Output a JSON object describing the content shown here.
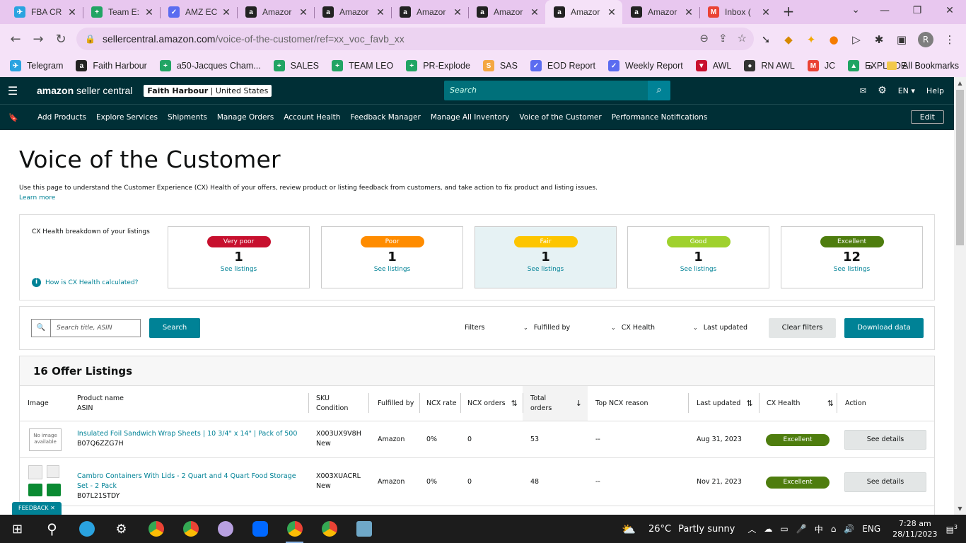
{
  "browser": {
    "tabs": [
      {
        "title": "FBA CR",
        "icon": "telegram-icon",
        "color": "#2aa3e0",
        "glyph": "✈"
      },
      {
        "title": "Team E:",
        "icon": "sheets-icon",
        "color": "#21a464",
        "glyph": "+"
      },
      {
        "title": "AMZ EC",
        "icon": "eod-icon",
        "color": "#5b6cf0",
        "glyph": "✓"
      },
      {
        "title": "Amazor",
        "icon": "amazon-icon",
        "color": "#222222",
        "glyph": "a"
      },
      {
        "title": "Amazor",
        "icon": "amazon-icon",
        "color": "#222222",
        "glyph": "a"
      },
      {
        "title": "Amazor",
        "icon": "amazon-icon",
        "color": "#222222",
        "glyph": "a"
      },
      {
        "title": "Amazor",
        "icon": "amazon-icon",
        "color": "#222222",
        "glyph": "a"
      },
      {
        "title": "Amazor",
        "icon": "amazon-icon",
        "color": "#222222",
        "glyph": "a",
        "active": true
      },
      {
        "title": "Amazor",
        "icon": "amazon-icon",
        "color": "#222222",
        "glyph": "a"
      },
      {
        "title": "Inbox (",
        "icon": "gmail-icon",
        "color": "#ea4335",
        "glyph": "M"
      }
    ],
    "url_host": "sellercentral.amazon.com",
    "url_path": "/voice-of-the-customer/ref=xx_voc_favb_xx",
    "bookmarks": [
      {
        "label": "Telegram",
        "color": "#2aa3e0",
        "glyph": "✈"
      },
      {
        "label": "Faith Harbour",
        "color": "#222222",
        "glyph": "a"
      },
      {
        "label": "a50-Jacques Cham...",
        "color": "#21a464",
        "glyph": "+"
      },
      {
        "label": "SALES",
        "color": "#21a464",
        "glyph": "+"
      },
      {
        "label": "TEAM LEO",
        "color": "#21a464",
        "glyph": "+"
      },
      {
        "label": "PR-Explode",
        "color": "#21a464",
        "glyph": "+"
      },
      {
        "label": "SAS",
        "color": "#f4a742",
        "glyph": "S"
      },
      {
        "label": "EOD Report",
        "color": "#5b6cf0",
        "glyph": "✓"
      },
      {
        "label": "Weekly Report",
        "color": "#5b6cf0",
        "glyph": "✓"
      },
      {
        "label": "AWL",
        "color": "#c8102e",
        "glyph": "▼"
      },
      {
        "label": "RN AWL",
        "color": "#333333",
        "glyph": "●"
      },
      {
        "label": "JC",
        "color": "#ea4335",
        "glyph": "M"
      },
      {
        "label": "EXPLODE",
        "color": "#1fa463",
        "glyph": "▲"
      }
    ],
    "all_bookmarks": "All Bookmarks"
  },
  "header": {
    "logo_brand": "amazon",
    "logo_suffix": " seller central",
    "account_name": "Faith Harbour",
    "account_region": " | United States",
    "search_placeholder": "Search",
    "language": "EN",
    "help": "Help",
    "nav_links": [
      "Add Products",
      "Explore Services",
      "Shipments",
      "Manage Orders",
      "Account Health",
      "Feedback Manager",
      "Manage All Inventory",
      "Voice of the Customer",
      "Performance Notifications"
    ],
    "edit": "Edit"
  },
  "page": {
    "title": "Voice of the Customer",
    "description": "Use this page to understand the Customer Experience (CX) Health of your offers, review product or listing feedback from customers, and take action to fix product and listing issues.",
    "learn_more": "Learn more"
  },
  "cx": {
    "label": "CX Health breakdown of your listings",
    "how_calc": "How is CX Health calculated?",
    "cards": [
      {
        "status": "Very poor",
        "count": "1",
        "link": "See listings",
        "color": "#c7102e"
      },
      {
        "status": "Poor",
        "count": "1",
        "link": "See listings",
        "color": "#ff8c00"
      },
      {
        "status": "Fair",
        "count": "1",
        "link": "See listings",
        "color": "#fdc500",
        "selected": true
      },
      {
        "status": "Good",
        "count": "1",
        "link": "See listings",
        "color": "#9fd12d"
      },
      {
        "status": "Excellent",
        "count": "12",
        "link": "See listings",
        "color": "#4e7d0e"
      }
    ]
  },
  "filters": {
    "search_placeholder": "Search title, ASIN",
    "search_button": "Search",
    "label": "Filters",
    "dropdowns": [
      "Fulfilled by",
      "CX Health",
      "Last updated"
    ],
    "clear": "Clear filters",
    "download": "Download data"
  },
  "listings": {
    "heading": "16 Offer Listings",
    "columns": {
      "image": "Image",
      "product": "Product name",
      "product_sub": "ASIN",
      "sku": "SKU",
      "sku_sub": "Condition",
      "fulfilled": "Fulfilled by",
      "ncx_rate": "NCX rate",
      "ncx_orders": "NCX orders",
      "total": "Total",
      "total_sub": "orders",
      "top_reason": "Top NCX reason",
      "last_updated": "Last updated",
      "cx_health": "CX Health",
      "action": "Action"
    },
    "rows": [
      {
        "image": "No image available",
        "name": "Insulated Foil Sandwich Wrap Sheets | 10 3/4\" x 14\" | Pack of 500",
        "asin": "B07Q6ZZG7H",
        "sku": "X003UX9V8H",
        "condition": "New",
        "fulfilled": "Amazon",
        "ncx_rate": "0%",
        "ncx_orders": "0",
        "total": "53",
        "reason": "--",
        "updated": "Aug 31, 2023",
        "health": "Excellent",
        "action": "See details"
      },
      {
        "image": "",
        "name": "Cambro Containers With Lids - 2 Quart and 4 Quart Food Storage Set - 2 Pack",
        "asin": "B07L21STDY",
        "sku": "X003XUACRL",
        "condition": "New",
        "fulfilled": "Amazon",
        "ncx_rate": "0%",
        "ncx_orders": "0",
        "total": "48",
        "reason": "--",
        "updated": "Nov 21, 2023",
        "health": "Excellent",
        "action": "See details"
      }
    ]
  },
  "feedback": "FEEDBACK",
  "taskbar": {
    "weather_temp": "26°C",
    "weather_text": "Partly sunny",
    "lang": "ENG",
    "time": "7:28 am",
    "date": "28/11/2023",
    "notifications": "3"
  }
}
